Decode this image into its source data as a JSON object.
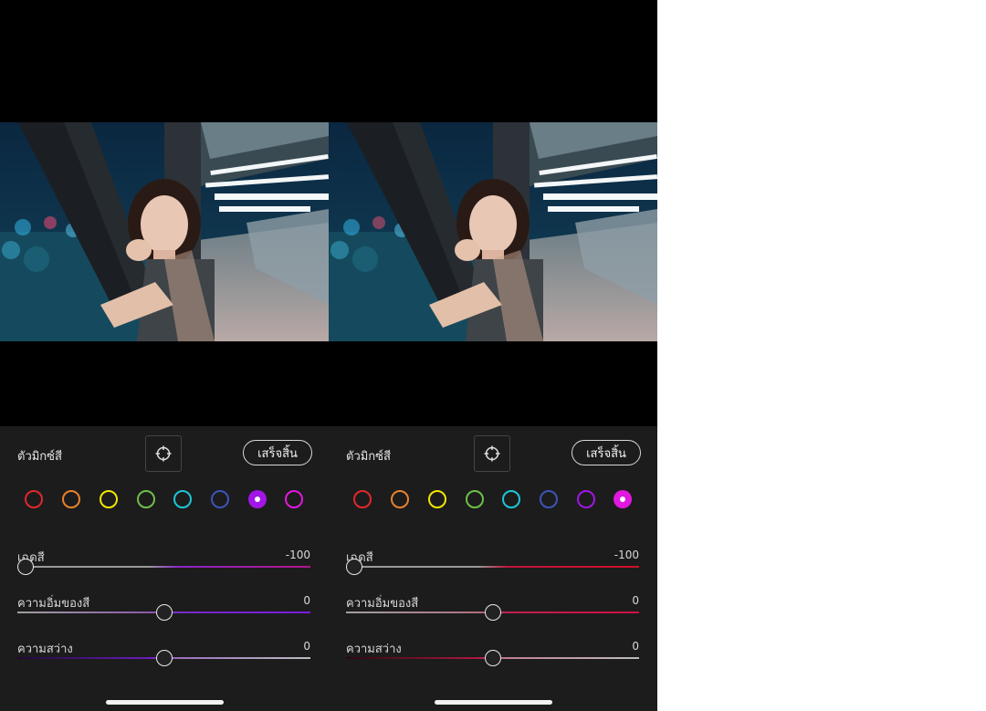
{
  "panels": [
    {
      "title": "ตัวมิกซ์สี",
      "done_label": "เสร็จสิ้น",
      "selected_color": "purple",
      "swatches": [
        {
          "name": "red",
          "color": "#e0282e"
        },
        {
          "name": "orange",
          "color": "#e8822a"
        },
        {
          "name": "yellow",
          "color": "#f2e600"
        },
        {
          "name": "green",
          "color": "#6cc04a"
        },
        {
          "name": "aqua",
          "color": "#1cc6d8"
        },
        {
          "name": "blue",
          "color": "#3c55b8"
        },
        {
          "name": "purple",
          "color": "#a116e6"
        },
        {
          "name": "magenta",
          "color": "#e018e0"
        }
      ],
      "sliders": [
        {
          "label": "เฉดสี",
          "value": "-100",
          "level": 0.0,
          "gradient": [
            "#9a9a9a",
            "#9a9a9a",
            "#8b25c8",
            "#b0158a"
          ]
        },
        {
          "label": "ความอิ่มของสี",
          "value": "0",
          "level": 0.5,
          "gradient": [
            "#a0a0a0",
            "#8a5aa8",
            "#7a2ac8",
            "#7a1ae0"
          ]
        },
        {
          "label": "ความสว่าง",
          "value": "0",
          "level": 0.5,
          "gradient": [
            "#200836",
            "#6a1ec0",
            "#9a70c0",
            "#bdbdbd"
          ]
        }
      ]
    },
    {
      "title": "ตัวมิกซ์สี",
      "done_label": "เสร็จสิ้น",
      "selected_color": "magenta",
      "swatches": [
        {
          "name": "red",
          "color": "#e0282e"
        },
        {
          "name": "orange",
          "color": "#e8822a"
        },
        {
          "name": "yellow",
          "color": "#f2e600"
        },
        {
          "name": "green",
          "color": "#6cc04a"
        },
        {
          "name": "aqua",
          "color": "#1cc6d8"
        },
        {
          "name": "blue",
          "color": "#3c55b8"
        },
        {
          "name": "purple",
          "color": "#a116e6"
        },
        {
          "name": "magenta",
          "color": "#e018e0"
        }
      ],
      "sliders": [
        {
          "label": "เฉดสี",
          "value": "-100",
          "level": 0.0,
          "gradient": [
            "#9a9a9a",
            "#9a9a9a",
            "#c0143a",
            "#d0102a"
          ]
        },
        {
          "label": "ความอิ่มของสี",
          "value": "0",
          "level": 0.5,
          "gradient": [
            "#a0a0a0",
            "#b07080",
            "#c02050",
            "#d01040"
          ]
        },
        {
          "label": "ความสว่าง",
          "value": "0",
          "level": 0.5,
          "gradient": [
            "#2a0810",
            "#b01840",
            "#c08090",
            "#bdbdbd"
          ]
        }
      ]
    }
  ],
  "colors": {
    "control_bg": "#1c1c1c",
    "screen_bg": "#000000"
  },
  "photo": {
    "description_icon": "night-bridge-portrait-photo"
  }
}
